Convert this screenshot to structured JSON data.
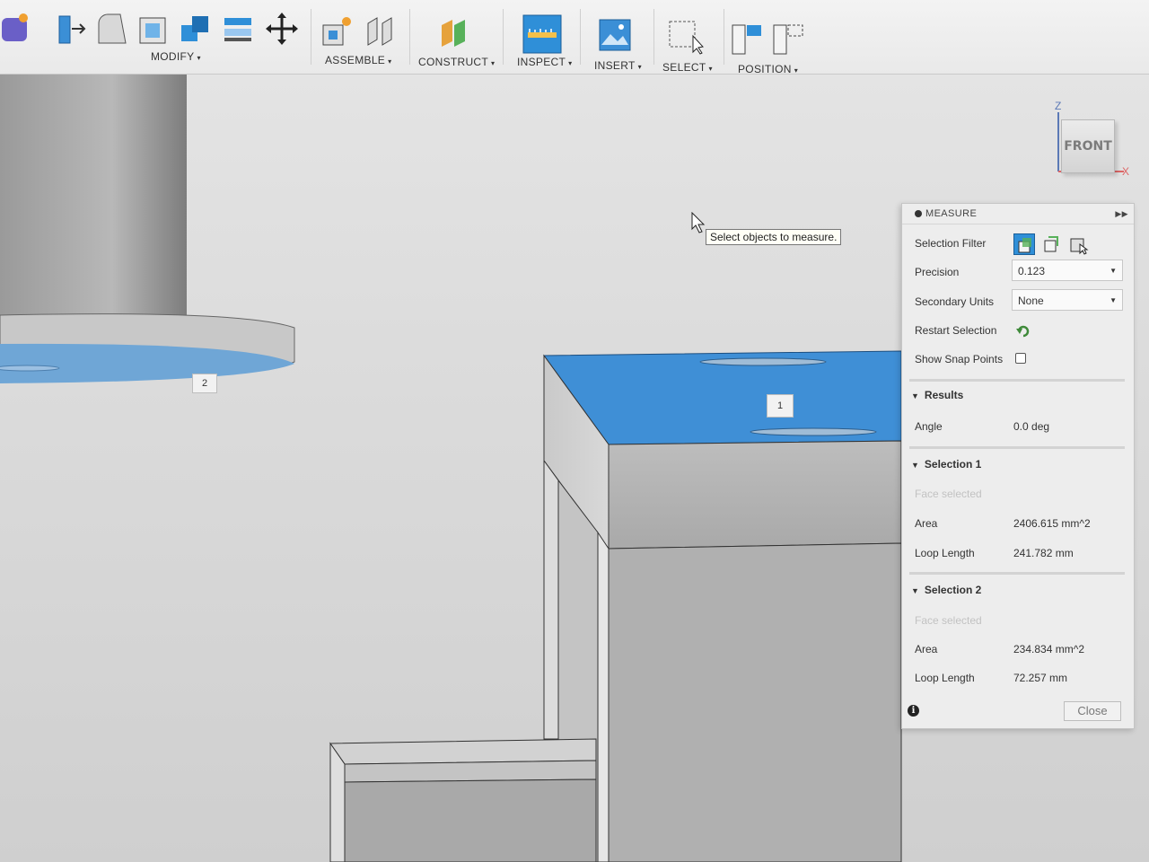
{
  "toolbar": {
    "groups": [
      {
        "label": "MODIFY"
      },
      {
        "label": "ASSEMBLE"
      },
      {
        "label": "CONSTRUCT"
      },
      {
        "label": "INSPECT"
      },
      {
        "label": "INSERT"
      },
      {
        "label": "SELECT"
      },
      {
        "label": "POSITION"
      }
    ],
    "caret": "▾"
  },
  "viewport": {
    "tooltip": "Select objects to measure.",
    "selection_tags": [
      "1",
      "2"
    ],
    "viewcube": {
      "face": "FRONT",
      "axis_z": "Z",
      "axis_x": "X"
    }
  },
  "measure": {
    "title": "MEASURE",
    "selection_filter_label": "Selection Filter",
    "precision_label": "Precision",
    "precision_value": "0.123",
    "secondary_units_label": "Secondary Units",
    "secondary_units_value": "None",
    "restart_selection_label": "Restart Selection",
    "show_snap_points_label": "Show Snap Points",
    "results": {
      "heading": "Results",
      "angle_label": "Angle",
      "angle_value": "0.0 deg"
    },
    "selection1": {
      "heading": "Selection 1",
      "status": "Face selected",
      "area_label": "Area",
      "area_value": "2406.615 mm^2",
      "loop_label": "Loop Length",
      "loop_value": "241.782 mm"
    },
    "selection2": {
      "heading": "Selection 2",
      "status": "Face selected",
      "area_label": "Area",
      "area_value": "234.834 mm^2",
      "loop_label": "Loop Length",
      "loop_value": "72.257 mm"
    },
    "close_label": "Close",
    "accent_color": "#2f8fd8"
  }
}
